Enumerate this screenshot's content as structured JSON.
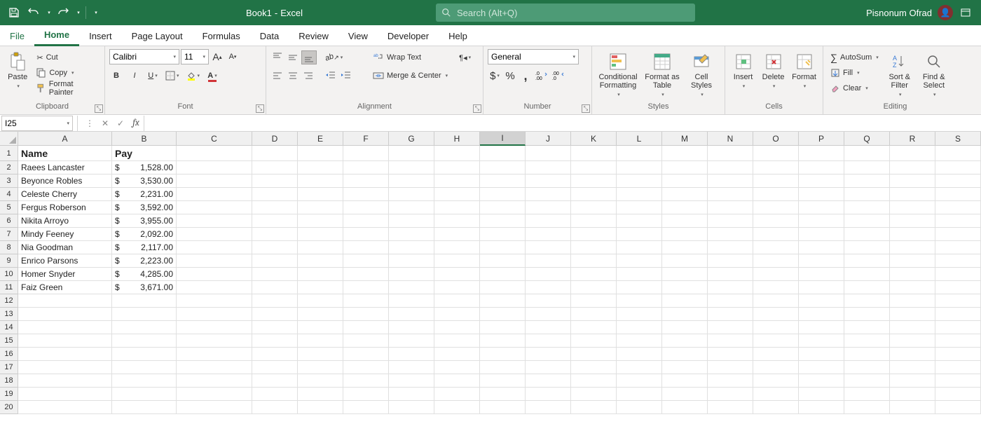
{
  "title": {
    "doc": "Book1",
    "sep": "-",
    "app": "Excel"
  },
  "search_placeholder": "Search (Alt+Q)",
  "user_name": "Pisnonum Ofrad",
  "tabs": [
    "File",
    "Home",
    "Insert",
    "Page Layout",
    "Formulas",
    "Data",
    "Review",
    "View",
    "Developer",
    "Help"
  ],
  "active_tab": "Home",
  "clipboard": {
    "paste": "Paste",
    "cut": "Cut",
    "copy": "Copy",
    "fp": "Format Painter",
    "label": "Clipboard"
  },
  "font": {
    "name": "Calibri",
    "size": "11",
    "label": "Font"
  },
  "alignment": {
    "wrap": "Wrap Text",
    "merge": "Merge & Center",
    "label": "Alignment"
  },
  "number": {
    "format": "General",
    "label": "Number"
  },
  "styles": {
    "cond": "Conditional Formatting",
    "fat": "Format as Table",
    "cell": "Cell Styles",
    "label": "Styles"
  },
  "cells": {
    "ins": "Insert",
    "del": "Delete",
    "fmt": "Format",
    "label": "Cells"
  },
  "editing": {
    "sum": "AutoSum",
    "fill": "Fill",
    "clear": "Clear",
    "sort": "Sort & Filter",
    "find": "Find & Select",
    "label": "Editing"
  },
  "namebox": "I25",
  "formula": "",
  "columns": [
    "A",
    "B",
    "C",
    "D",
    "E",
    "F",
    "G",
    "H",
    "I",
    "J",
    "K",
    "L",
    "M",
    "N",
    "O",
    "P",
    "Q",
    "R",
    "S"
  ],
  "selected_col": "I",
  "row_count": 20,
  "headers": {
    "A": "Name",
    "B": "Pay"
  },
  "data": [
    {
      "name": "Raees Lancaster",
      "pay": "1,528.00"
    },
    {
      "name": "Beyonce Robles",
      "pay": "3,530.00"
    },
    {
      "name": "Celeste Cherry",
      "pay": "2,231.00"
    },
    {
      "name": "Fergus Roberson",
      "pay": "3,592.00"
    },
    {
      "name": "Nikita Arroyo",
      "pay": "3,955.00"
    },
    {
      "name": "Mindy Feeney",
      "pay": "2,092.00"
    },
    {
      "name": "Nia Goodman",
      "pay": "2,117.00"
    },
    {
      "name": "Enrico Parsons",
      "pay": "2,223.00"
    },
    {
      "name": "Homer Snyder",
      "pay": "4,285.00"
    },
    {
      "name": "Faiz Green",
      "pay": "3,671.00"
    }
  ],
  "currency": "$"
}
